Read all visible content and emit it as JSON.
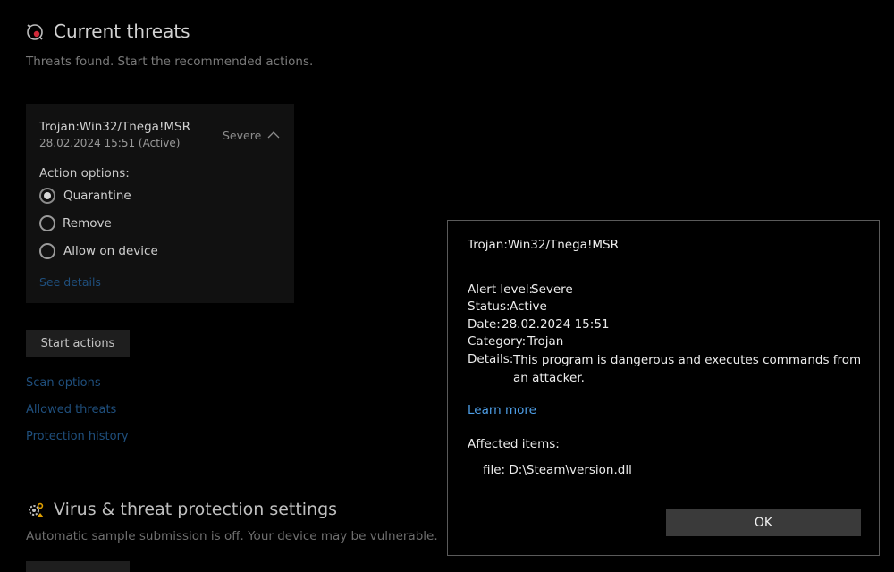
{
  "current_threats": {
    "title": "Current threats",
    "subtitle": "Threats found. Start the recommended actions.",
    "icon": "threat-scan-icon"
  },
  "threat_card": {
    "name": "Trojan:Win32/Tnega!MSR",
    "date": "28.02.2024 15:51 (Active)",
    "severity": "Severe",
    "action_options_label": "Action options:",
    "options": [
      "Quarantine",
      "Remove",
      "Allow on device"
    ],
    "selected_option": "Quarantine",
    "see_details": "See details"
  },
  "start_actions_label": "Start actions",
  "links": [
    "Scan options",
    "Allowed threats",
    "Protection history"
  ],
  "virus_settings": {
    "title": "Virus & threat protection settings",
    "subtitle": "Automatic sample submission is off. Your device may be vulnerable.",
    "icon": "settings-gear-icon"
  },
  "dialog": {
    "title": "Trojan:Win32/Tnega!MSR",
    "fields": [
      {
        "key": "Alert level:",
        "value": "Severe"
      },
      {
        "key": "Status:",
        "value": "Active"
      },
      {
        "key": "Date:",
        "value": "28.02.2024 15:51"
      },
      {
        "key": "Category:",
        "value": "Trojan"
      },
      {
        "key": "Details:",
        "value": "This program is dangerous and executes commands from an attacker."
      }
    ],
    "learn_more": "Learn more",
    "affected_items_label": "Affected items:",
    "affected_file": "file: D:\\Steam\\version.dll",
    "ok_label": "OK"
  },
  "colors": {
    "background": "#000000",
    "link": "#4e9ee6",
    "dim_link": "#1f4f7d",
    "button": "#3a3a3a"
  }
}
